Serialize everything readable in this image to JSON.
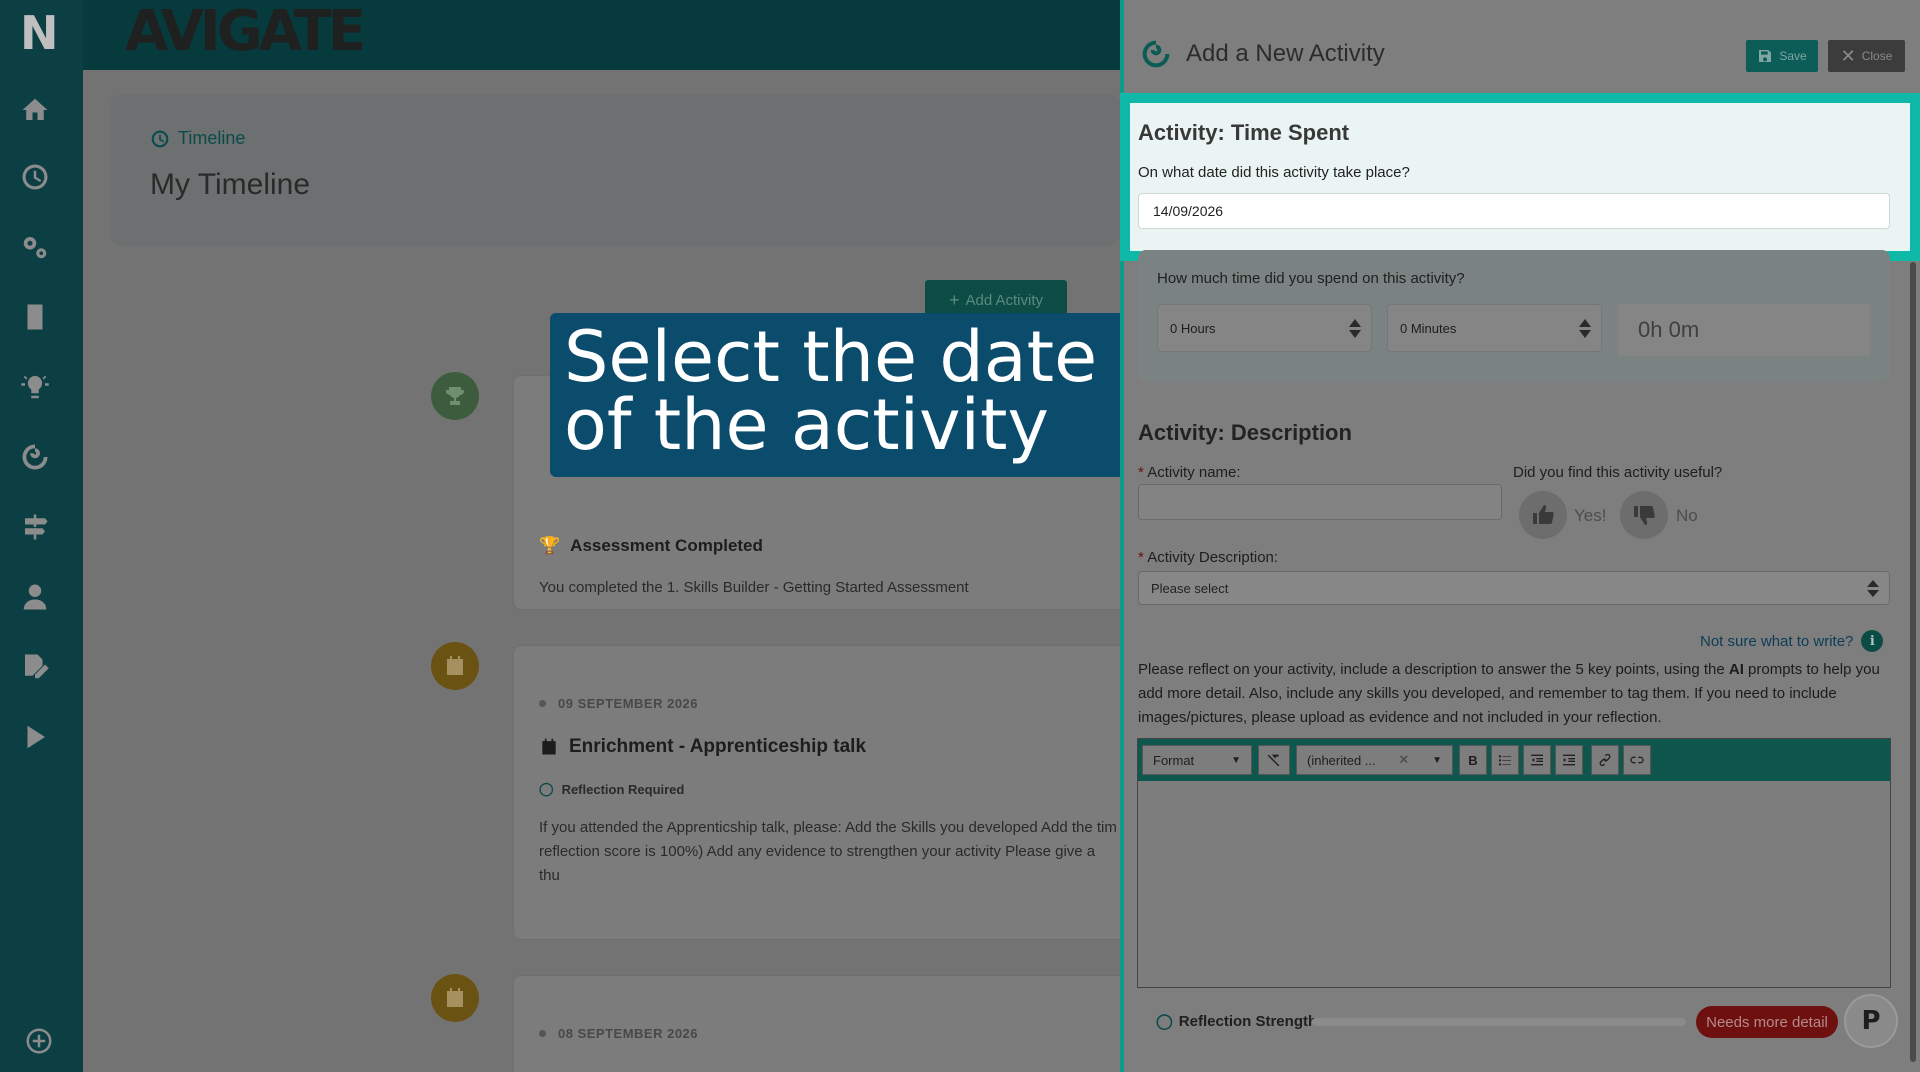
{
  "app": {
    "brand": "AVIGATE",
    "logo_letter": "N"
  },
  "sidebar": {
    "items": [
      {
        "name": "home-icon"
      },
      {
        "name": "clock-icon"
      },
      {
        "name": "gears-icon"
      },
      {
        "name": "book-icon"
      },
      {
        "name": "lightbulb-icon"
      },
      {
        "name": "spiral-icon"
      },
      {
        "name": "signpost-icon"
      },
      {
        "name": "user-icon"
      },
      {
        "name": "edit-icon"
      },
      {
        "name": "play-icon"
      }
    ],
    "bottom": "plus-circle-icon"
  },
  "page": {
    "breadcrumb": "Timeline",
    "title": "My Timeline",
    "add_activity": "Add Activity"
  },
  "timeline": {
    "cards": [
      {
        "title": "Assessment Completed",
        "body": "You completed the 1. Skills Builder - Getting Started Assessment"
      },
      {
        "date": "09 SEPTEMBER 2026",
        "title": "Enrichment - Apprenticeship talk",
        "tag": "Reflection Required",
        "body": "If you attended the Apprenticship talk, please: Add the Skills you developed Add the tim reflection score is 100%) Add any evidence to strengthen your activity Please give a thu"
      },
      {
        "date": "08 SEPTEMBER 2026"
      }
    ]
  },
  "callout": {
    "text": "Select the date of the activity"
  },
  "panel": {
    "title": "Add a New Activity",
    "save": "Save",
    "close": "Close",
    "time_spent": {
      "heading": "Activity: Time Spent",
      "date_question": "On what date did this activity take place?",
      "date_value": "14/09/2026",
      "time_question": "How much time did you spend on this activity?",
      "hours": "0 Hours",
      "minutes": "0 Minutes",
      "total": "0h 0m"
    },
    "description": {
      "heading": "Activity: Description",
      "name_label": "Activity name:",
      "useful_label": "Did you find this activity useful?",
      "yes": "Yes!",
      "no": "No",
      "desc_label": "Activity Description:",
      "desc_value": "Please select",
      "not_sure": "Not sure what to write?",
      "para_before": "Please reflect on your activity, include a description to answer the 5 key points, using the ",
      "para_bold": "AI",
      "para_after": " prompts to help you add more detail. Also, include any skills you developed, and remember to tag them. If you need to include images/pictures, please upload as evidence and not included in your reflection."
    },
    "editor": {
      "format": "Format",
      "font": "(inherited ..."
    },
    "strength": {
      "label": "Reflection Strength",
      "status": "Needs more detail",
      "level": 0.0
    }
  },
  "colors": {
    "accent": "#0fb9a7",
    "brand": "#0b3f44",
    "callout": "#0b4b6b",
    "danger": "#6f1010"
  }
}
